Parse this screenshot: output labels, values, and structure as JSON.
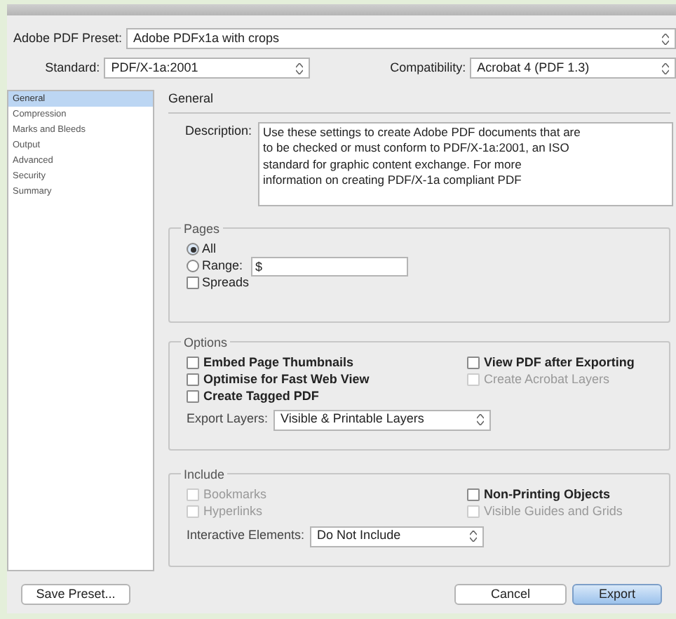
{
  "preset": {
    "label": "Adobe PDF Preset:",
    "value": "Adobe PDFx1a with crops"
  },
  "standard": {
    "label": "Standard:",
    "value": "PDF/X-1a:2001"
  },
  "compatibility": {
    "label": "Compatibility:",
    "value": "Acrobat 4 (PDF 1.3)"
  },
  "sidebar": {
    "items": [
      {
        "label": "General",
        "selected": true
      },
      {
        "label": "Compression",
        "selected": false
      },
      {
        "label": "Marks and Bleeds",
        "selected": false
      },
      {
        "label": "Output",
        "selected": false
      },
      {
        "label": "Advanced",
        "selected": false
      },
      {
        "label": "Security",
        "selected": false
      },
      {
        "label": "Summary",
        "selected": false
      }
    ]
  },
  "section_title": "General",
  "description": {
    "label": "Description:",
    "lines": [
      "Use these settings to create Adobe PDF documents that are",
      "to be checked or must conform to PDF/X-1a:2001, an ISO",
      "standard for graphic content exchange.  For more",
      "information on creating PDF/X-1a compliant PDF"
    ]
  },
  "pages": {
    "title": "Pages",
    "options": [
      {
        "kind": "radio",
        "label": "All",
        "selected": true
      },
      {
        "kind": "radio",
        "label": "Range:",
        "selected": false,
        "value": "$"
      },
      {
        "kind": "checkbox",
        "label": "Spreads",
        "checked": false
      }
    ]
  },
  "options": {
    "title": "Options",
    "items": [
      {
        "label": "Embed Page Thumbnails",
        "checked": false,
        "disabled": false
      },
      {
        "label": "View PDF after Exporting",
        "checked": false,
        "disabled": false
      },
      {
        "label": "Optimise for Fast Web View",
        "checked": false,
        "disabled": false
      },
      {
        "label": "Create Acrobat Layers",
        "checked": false,
        "disabled": true
      },
      {
        "label": "Create Tagged PDF",
        "checked": false,
        "disabled": false
      }
    ],
    "export_layers": {
      "label": "Export Layers:",
      "value": "Visible & Printable Layers"
    }
  },
  "include": {
    "title": "Include",
    "items": [
      {
        "label": "Bookmarks",
        "checked": false,
        "disabled": true
      },
      {
        "label": "Non-Printing Objects",
        "checked": false,
        "disabled": false
      },
      {
        "label": "Hyperlinks",
        "checked": false,
        "disabled": true
      },
      {
        "label": "Visible Guides and Grids",
        "checked": false,
        "disabled": true
      }
    ],
    "interactive": {
      "label": "Interactive Elements:",
      "value": "Do Not Include"
    }
  },
  "buttons": [
    {
      "label": "Save Preset...",
      "kind": "secondary"
    },
    {
      "label": "Cancel",
      "kind": "secondary"
    },
    {
      "label": "Export",
      "kind": "default"
    }
  ]
}
